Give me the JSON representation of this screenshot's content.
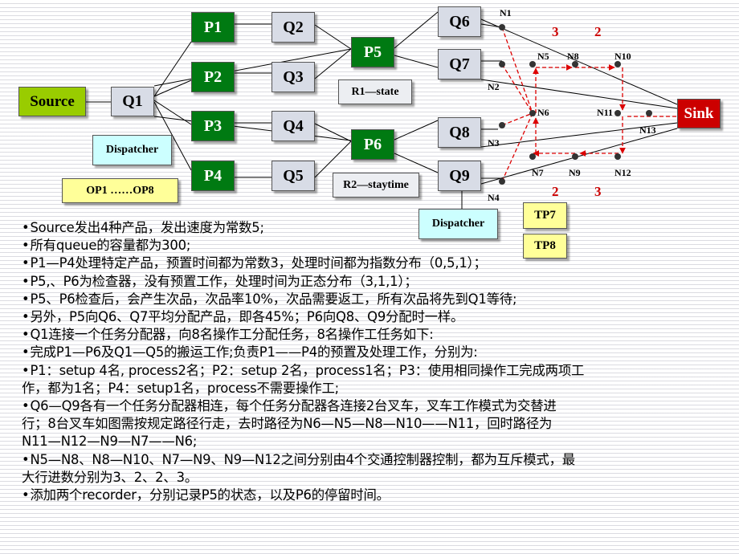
{
  "diagram": {
    "source": "Source",
    "sink": "Sink",
    "queues": [
      "Q1",
      "Q2",
      "Q3",
      "Q4",
      "Q5",
      "Q6",
      "Q7",
      "Q8",
      "Q9"
    ],
    "processors": [
      "P1",
      "P2",
      "P3",
      "P4",
      "P5",
      "P6"
    ],
    "recorders": [
      "R1—state",
      "R2—staytime"
    ],
    "dispatchers": [
      "Dispatcher",
      "Dispatcher"
    ],
    "operators": "OP1 ……OP8",
    "transporters": [
      "TP7",
      "TP8"
    ],
    "nodes": [
      "N1",
      "N2",
      "N3",
      "N4",
      "N5",
      "N6",
      "N7",
      "N8",
      "N9",
      "N10",
      "N11",
      "N12",
      "N13"
    ],
    "traffic_limits_top": [
      "3",
      "2"
    ],
    "traffic_limits_bottom": [
      "2",
      "3"
    ],
    "colors": {
      "processor": "#007a12",
      "queue": "#d8dce6",
      "source": "#99cc00",
      "sink": "#cc0000",
      "dispatcher": "#ccffff",
      "operator": "#ffff99",
      "path": "#dd0000"
    }
  },
  "notes": [
    {
      "bullet": true,
      "text": "Source发出4种产品，发出速度为常数5;"
    },
    {
      "bullet": true,
      "text": "所有queue的容量都为300;"
    },
    {
      "bullet": true,
      "text": "P1—P4处理特定产品，预置时间都为常数3，处理时间都为指数分布（0,5,1）；"
    },
    {
      "bullet": true,
      "text": "P5,、P6为检查器，没有预置工作，处理时间为正态分布（3,1,1）；"
    },
    {
      "bullet": true,
      "text": "P5、P6检查后，会产生次品，次品率10%，次品需要返工，所有次品将先到Q1等待;"
    },
    {
      "bullet": true,
      "text": "另外，P5向Q6、Q7平均分配产品，即各45%；P6向Q8、Q9分配时一样。"
    },
    {
      "bullet": true,
      "text": "Q1连接一个任务分配器，向8名操作工分配任务，8名操作工任务如下:"
    },
    {
      "bullet": true,
      "text": "完成P1—P6及Q1—Q5的搬运工作;负责P1——P4的预置及处理工作，分别为:"
    },
    {
      "bullet": true,
      "text": "P1：setup 4名, process2名；P2：setup 2名，process1名；P3：使用相同操作工完成两项工"
    },
    {
      "bullet": false,
      "text": "作，都为1名；P4：setup1名，process不需要操作工;"
    },
    {
      "bullet": true,
      "text": "Q6—Q9各有一个任务分配器相连，每个任务分配器各连接2台叉车，叉车工作模式为交替进"
    },
    {
      "bullet": false,
      "text": "行；8台叉车如图需按规定路径行走，去时路径为N6—N5—N8—N10——N11，回时路径为"
    },
    {
      "bullet": false,
      "text": "N11—N12—N9—N7——N6;"
    },
    {
      "bullet": true,
      "text": "N5—N8、N8—N10、N7—N9、N9—N12之间分别由4个交通控制器控制，都为互斥模式，最"
    },
    {
      "bullet": false,
      "text": "大行进数分别为3、2、2、3。"
    },
    {
      "bullet": true,
      "text": "添加两个recorder，分别记录P5的状态，以及P6的停留时间。"
    }
  ]
}
